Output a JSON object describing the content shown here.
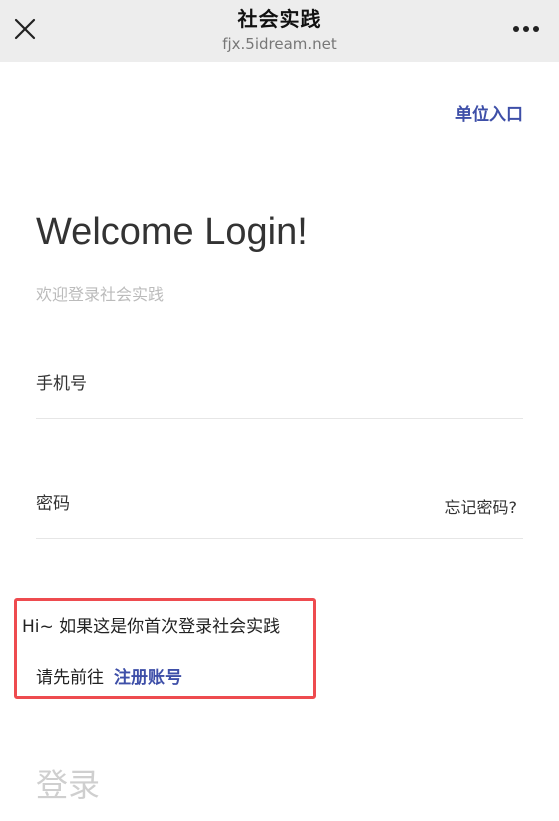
{
  "header": {
    "title": "社会实践",
    "subtitle": "fjx.5idream.net",
    "close_icon": "close-icon",
    "more_icon": "more-horizontal-icon"
  },
  "main": {
    "unit_entry": "单位入口",
    "welcome_title": "Welcome Login!",
    "welcome_subtitle": "欢迎登录社会实践",
    "phone_placeholder": "手机号",
    "password_placeholder": "密码",
    "forgot_password": "忘记密码?",
    "notice_line1": "Hi~ 如果这是你首次登录社会实践",
    "notice_line2": "请先前往",
    "register_link": "注册账号",
    "login_button": "登录"
  },
  "colors": {
    "accent": "#3e4fa8",
    "highlight_border": "#ee4b4f",
    "header_bg": "#ededed"
  }
}
